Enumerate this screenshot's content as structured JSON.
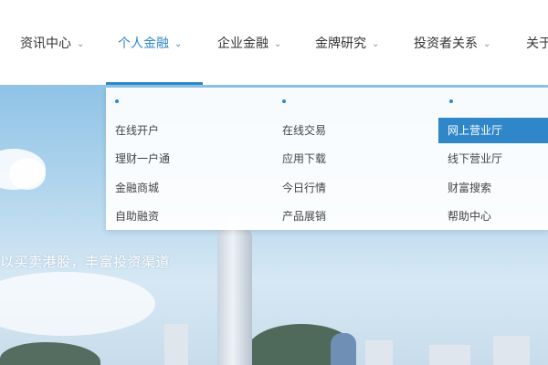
{
  "nav": {
    "items": [
      {
        "label": "资讯中心",
        "active": false
      },
      {
        "label": "个人金融",
        "active": true
      },
      {
        "label": "企业金融",
        "active": false
      },
      {
        "label": "金牌研究",
        "active": false
      },
      {
        "label": "投资者关系",
        "active": false
      },
      {
        "label": "关于",
        "active": false
      }
    ],
    "chevron": "⌄"
  },
  "dropdown": {
    "columns": [
      {
        "items": [
          "在线开户",
          "理财一户通",
          "金融商城",
          "自助融资"
        ]
      },
      {
        "items": [
          "在线交易",
          "应用下载",
          "今日行情",
          "产品展销"
        ]
      },
      {
        "items": [
          "网上营业厅",
          "线下营业厅",
          "财富搜索",
          "帮助中心"
        ],
        "selected_index": 0
      }
    ]
  },
  "hero": {
    "tagline": "以买卖港股，丰富投资渠道"
  },
  "colors": {
    "accent": "#2f86c9",
    "nav_text": "#333333"
  }
}
